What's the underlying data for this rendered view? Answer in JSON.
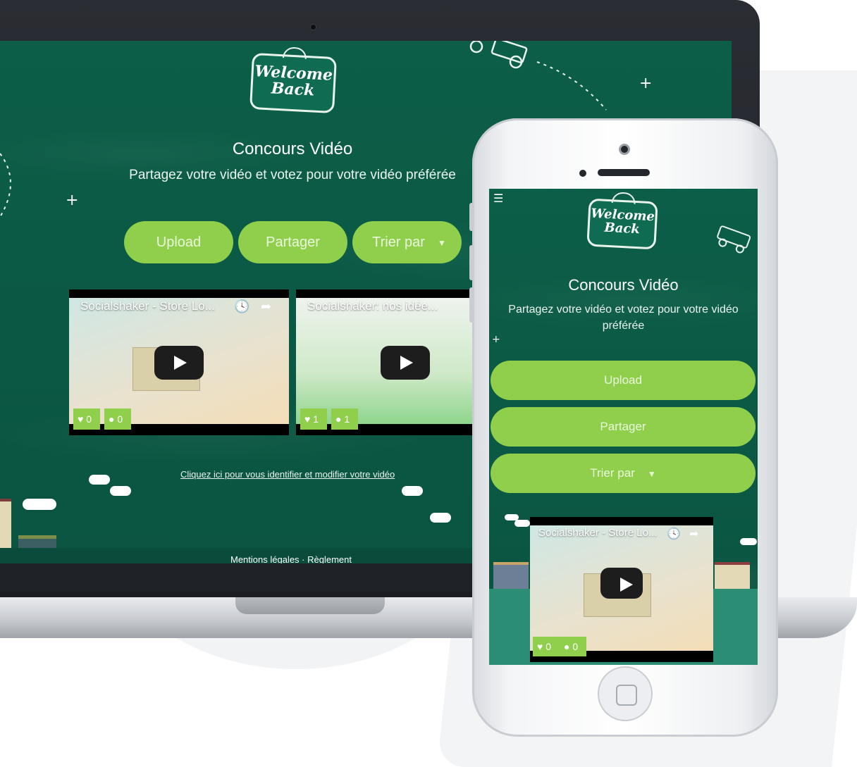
{
  "laptop": {
    "logo": [
      "Welcome",
      "Back"
    ],
    "title": "Concours Vidéo",
    "subtitle": "Partagez votre vidéo et votez pour votre vidéo préférée",
    "buttons": {
      "upload": "Upload",
      "share": "Partager",
      "sort": "Trier par"
    },
    "videos": [
      {
        "title": "Socialshaker - Store Lo...",
        "likes": "0",
        "comments": "0"
      },
      {
        "title": "Socialshaker: nos idée...",
        "likes": "1",
        "comments": "1"
      }
    ],
    "login_link": "Cliquez ici pour vous identifier et modifier votre vidéo",
    "footer": "Mentions légales · Règlement"
  },
  "phone": {
    "logo": [
      "Welcome",
      "Back"
    ],
    "title": "Concours Vidéo",
    "subtitle": "Partagez votre vidéo et votez pour votre vidéo préférée",
    "buttons": {
      "upload": "Upload",
      "share": "Partager",
      "sort": "Trier par"
    },
    "video": {
      "title": "Socialshaker - Store Lo...",
      "likes": "0",
      "comments": "0"
    }
  },
  "icons": {
    "menu": "hamburger-icon",
    "clock": "clock-icon",
    "share": "share-arrow-icon",
    "heart": "heart-icon",
    "comment": "comment-icon",
    "play": "play-icon",
    "caret": "caret-down-icon"
  },
  "colors": {
    "board_green": "#0b5a45",
    "button_green": "#8fcf4c"
  }
}
